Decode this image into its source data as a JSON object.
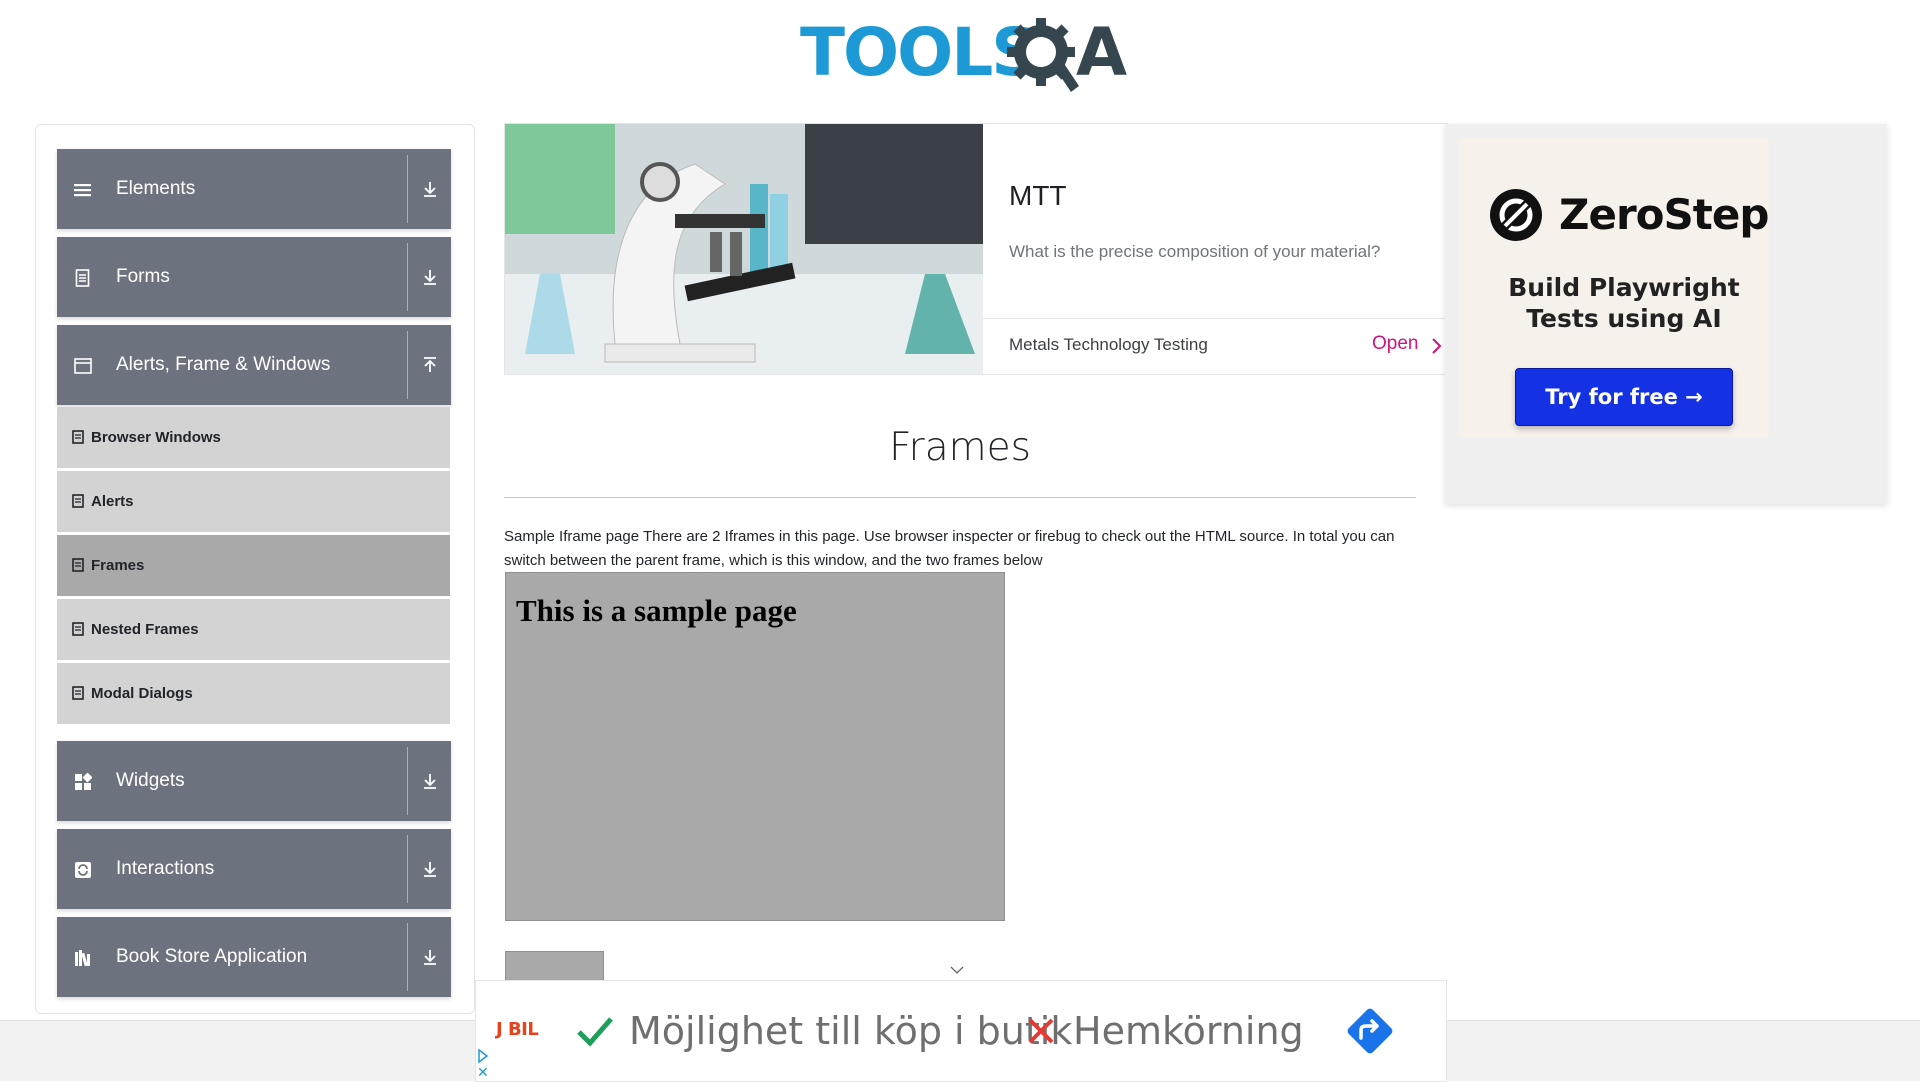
{
  "header": {
    "logo_text": "TOOLSQA",
    "logo_tools": "TOOLS",
    "logo_a": "A"
  },
  "sidebar": {
    "groups": [
      {
        "label": "Elements",
        "icon": "list-icon",
        "expanded": false
      },
      {
        "label": "Forms",
        "icon": "form-icon",
        "expanded": false
      },
      {
        "label": "Alerts, Frame & Windows",
        "icon": "window-icon",
        "expanded": true
      },
      {
        "label": "Widgets",
        "icon": "widgets-icon",
        "expanded": false
      },
      {
        "label": "Interactions",
        "icon": "interactions-icon",
        "expanded": false
      },
      {
        "label": "Book Store Application",
        "icon": "books-icon",
        "expanded": false
      }
    ],
    "subitems": [
      {
        "label": "Browser Windows",
        "active": false
      },
      {
        "label": "Alerts",
        "active": false
      },
      {
        "label": "Frames",
        "active": true
      },
      {
        "label": "Nested Frames",
        "active": false
      },
      {
        "label": "Modal Dialogs",
        "active": false
      }
    ]
  },
  "top_ad": {
    "title": "MTT",
    "description": "What is the precise composition of your material?",
    "brand": "Metals Technology Testing",
    "cta": "Open",
    "cta_color": "#d1127f"
  },
  "right_ad": {
    "brand": "ZeroStep",
    "tagline_line1": "Build Playwright",
    "tagline_line2": "Tests using AI",
    "cta": "Try for free →",
    "cta_color": "#1431e4"
  },
  "main": {
    "title": "Frames",
    "intro": "Sample Iframe page There are 2 Iframes in this page. Use browser inspecter or firebug to check out the HTML source. In total you can switch between the parent frame, which is this window, and the two frames below",
    "frame1_heading": "This is a sample page"
  },
  "bottom_ad": {
    "brand": "J BIL",
    "text1": "Möjlighet till köp i butik",
    "text2": "Hemkörning",
    "check_color": "#1e9e5a",
    "cross_color": "#e53935"
  },
  "colors": {
    "sidebar_group_bg": "#6c737e",
    "sidebar_sub_bg": "#d3d3d3",
    "sidebar_sub_active_bg": "#a9a9a9",
    "logo_blue": "#1d9ad6",
    "logo_dark": "#36464f"
  }
}
